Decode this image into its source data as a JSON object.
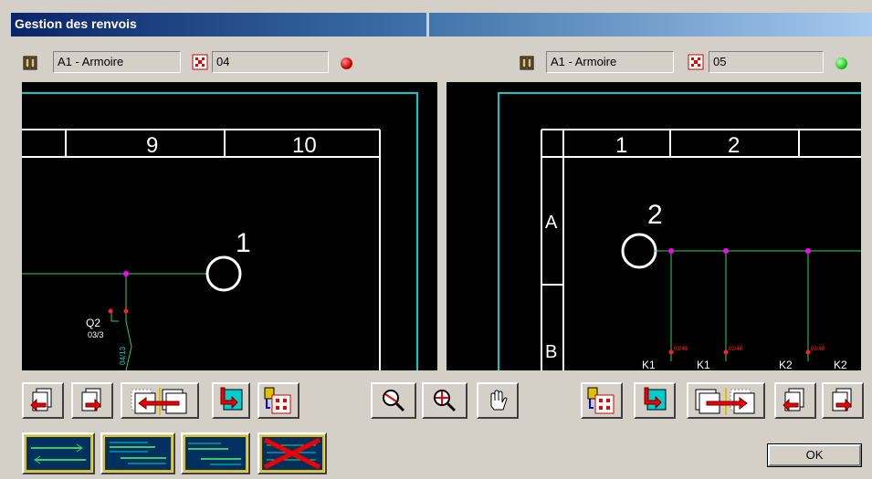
{
  "window": {
    "title": "Gestion des renvois"
  },
  "left": {
    "cabinet": "A1 - Armoire",
    "page": "04",
    "status_color": "#cc0000",
    "columns": [
      "9",
      "10"
    ],
    "marker": "1",
    "component": "Q2",
    "component_ref": "03/3",
    "wire_ref": "04/13"
  },
  "right": {
    "cabinet": "A1 - Armoire",
    "page": "05",
    "status_color": "#22cc22",
    "columns": [
      "1",
      "2"
    ],
    "rows": [
      "A",
      "B"
    ],
    "marker": "2",
    "contacts": [
      "K1",
      "K1",
      "K2",
      "K2"
    ],
    "contact_ref": "03/48"
  },
  "buttons": {
    "ok": "OK"
  },
  "colors": {
    "frame": "#00cccc",
    "border": "#ffffff",
    "wire": "#33cc66",
    "node": "#ff00ff",
    "pin": "#ff2222"
  }
}
